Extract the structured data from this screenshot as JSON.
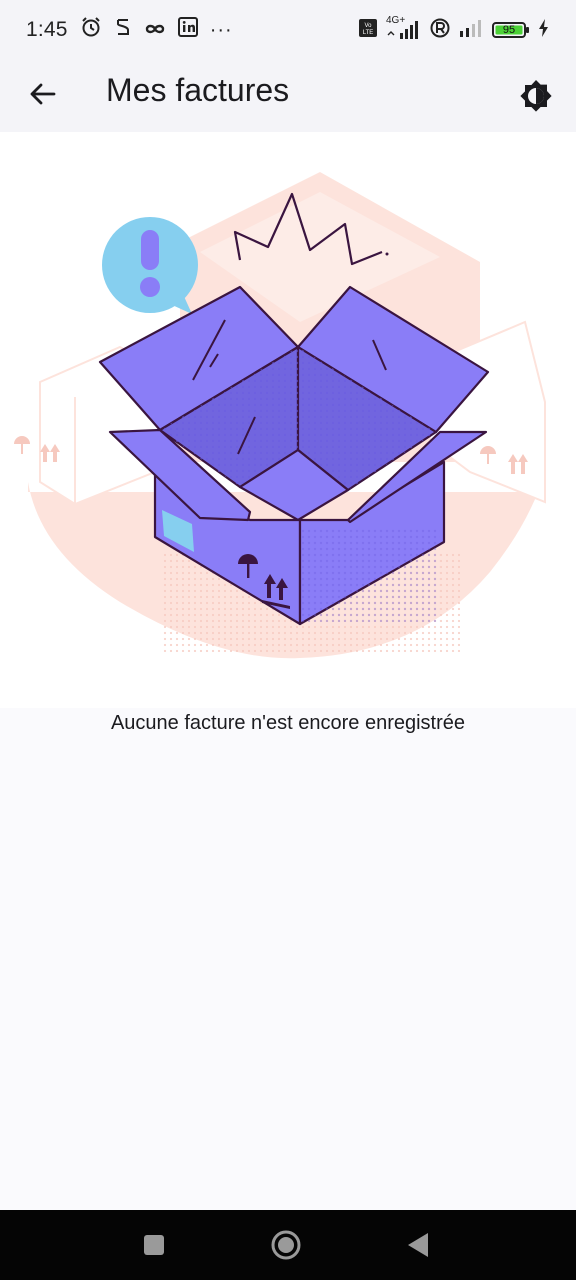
{
  "status_bar": {
    "time": "1:45",
    "battery": "95",
    "network": "4G+",
    "volte": "Vo LTE",
    "more": "···"
  },
  "app_bar": {
    "title": "Mes factures"
  },
  "empty_state": {
    "message": "Aucune facture n'est encore enregistrée"
  },
  "colors": {
    "box": "#8a7df7",
    "box_outline": "#3a1540",
    "bubble": "#86cfef",
    "background_shape": "#fde3dc"
  }
}
